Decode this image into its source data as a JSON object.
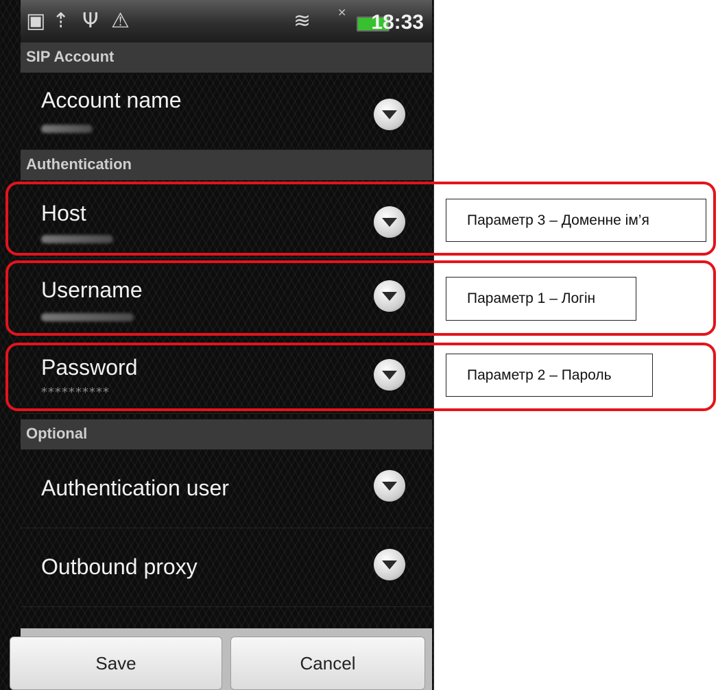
{
  "status_bar": {
    "time": "18:33",
    "icons": [
      "briefcase-icon",
      "upload-icon",
      "usb-icon",
      "warning-icon",
      "wifi-icon",
      "signal-icon",
      "battery-icon"
    ]
  },
  "sections": {
    "sip_account": "SIP Account",
    "authentication": "Authentication",
    "optional": "Optional"
  },
  "rows": {
    "account_name": {
      "title": "Account name"
    },
    "host": {
      "title": "Host"
    },
    "username": {
      "title": "Username"
    },
    "password": {
      "title": "Password",
      "value": "**********"
    },
    "authentication_user": {
      "title": "Authentication user"
    },
    "outbound_proxy": {
      "title": "Outbound proxy"
    }
  },
  "buttons": {
    "save": "Save",
    "cancel": "Cancel"
  },
  "annotations": {
    "param3": "Параметр 3 – Доменне ім’я",
    "param1": "Параметр 1 – Логін",
    "param2": "Параметр 2 – Пароль"
  },
  "colors": {
    "highlight": "#e3141b",
    "battery": "#37c12f"
  }
}
